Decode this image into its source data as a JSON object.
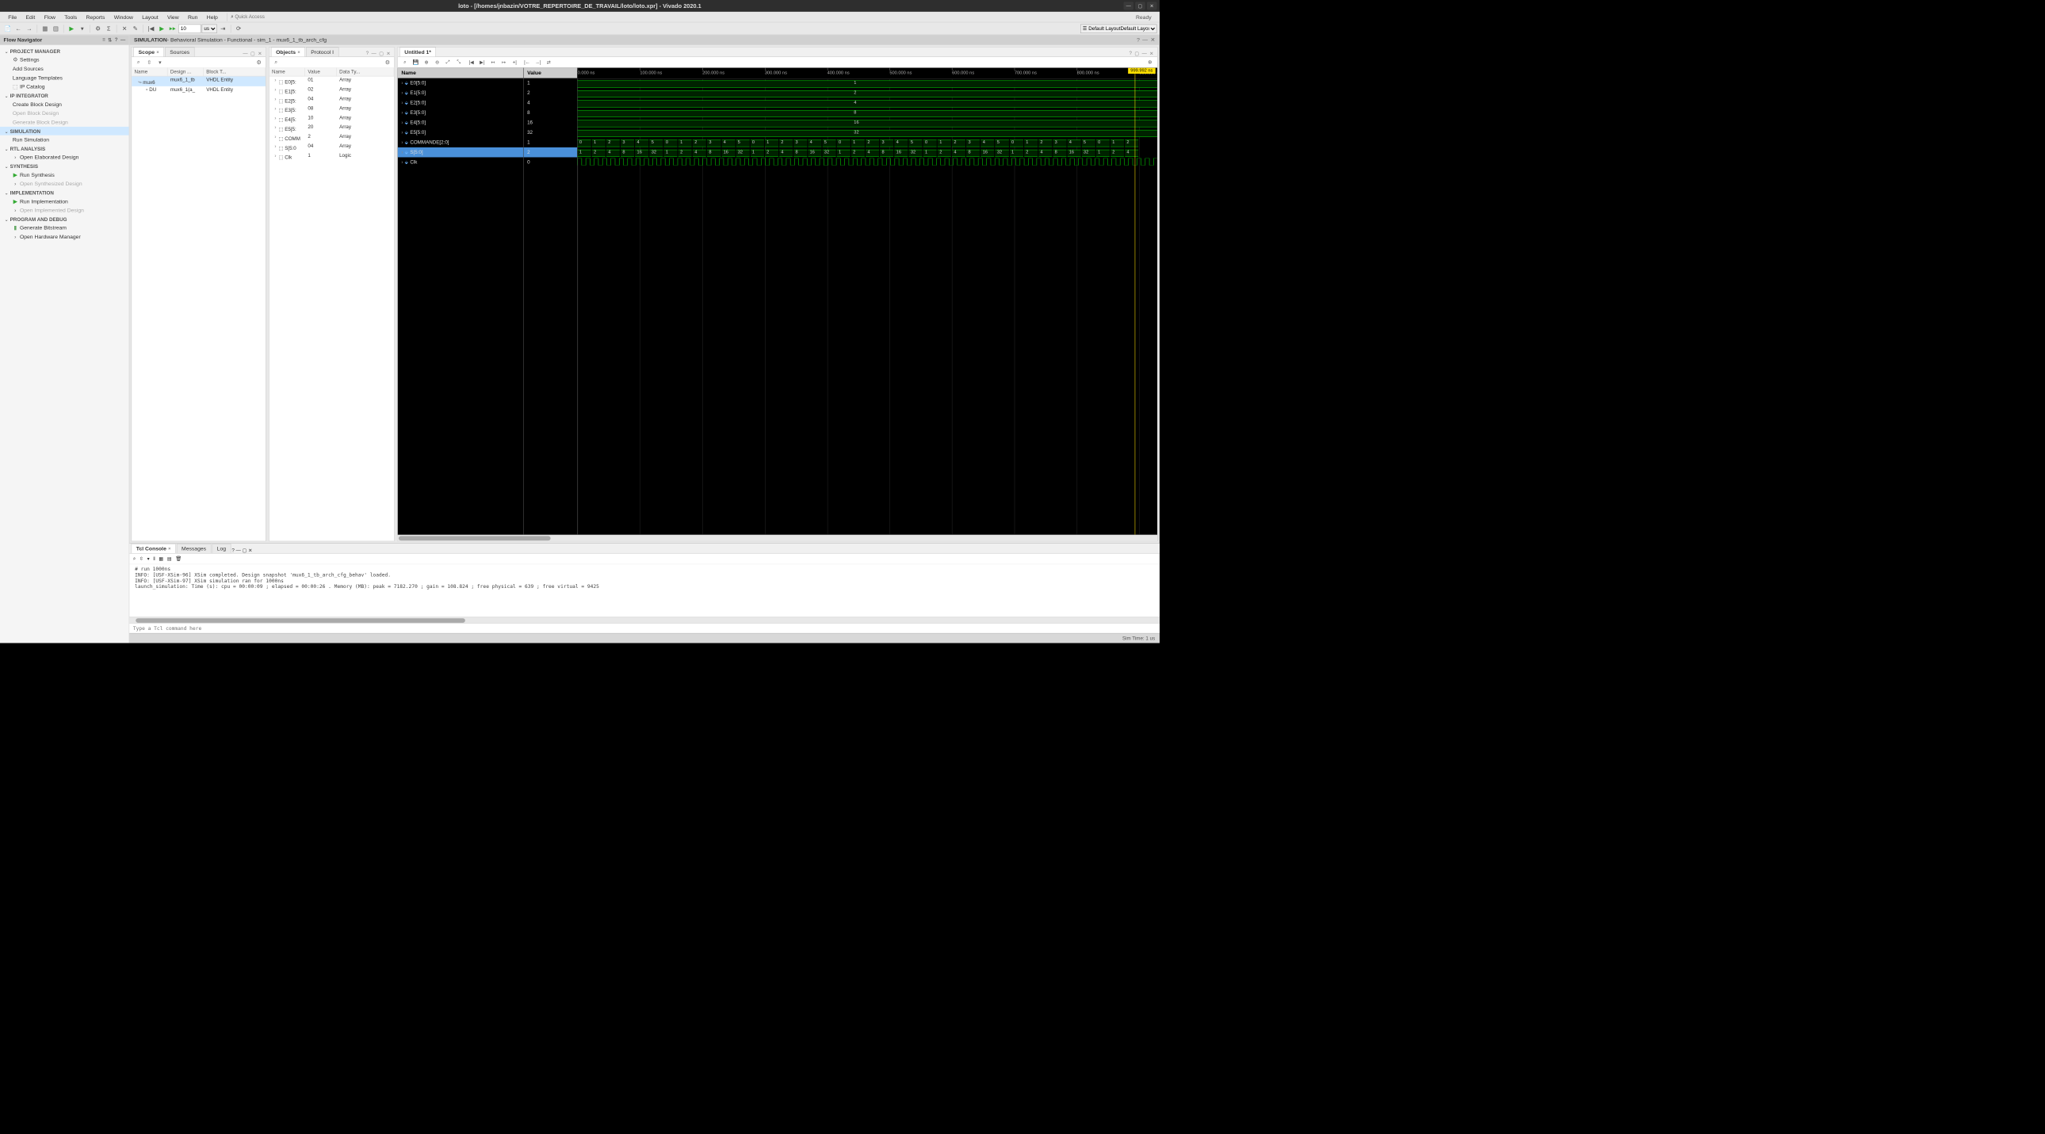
{
  "window": {
    "title": "loto - [/homes/jnbazin/VOTRE_REPERTOIRE_DE_TRAVAIL/loto/loto.xpr] - Vivado 2020.1"
  },
  "menu": [
    "File",
    "Edit",
    "Flow",
    "Tools",
    "Reports",
    "Window",
    "Layout",
    "View",
    "Run",
    "Help"
  ],
  "quick_access_placeholder": "Quick Access",
  "ready": "Ready",
  "toolbar": {
    "run_for_value": "10",
    "run_for_unit": "us",
    "layout": "Default Layout"
  },
  "flow_nav": {
    "title": "Flow Navigator",
    "sections": [
      {
        "label": "PROJECT MANAGER",
        "items": [
          {
            "label": "Settings",
            "icon": "gear"
          },
          {
            "label": "Add Sources"
          },
          {
            "label": "Language Templates"
          },
          {
            "label": "IP Catalog",
            "icon": "ip"
          }
        ]
      },
      {
        "label": "IP INTEGRATOR",
        "items": [
          {
            "label": "Create Block Design"
          },
          {
            "label": "Open Block Design",
            "disabled": true
          },
          {
            "label": "Generate Block Design",
            "disabled": true
          }
        ]
      },
      {
        "label": "SIMULATION",
        "selected": true,
        "items": [
          {
            "label": "Run Simulation"
          }
        ]
      },
      {
        "label": "RTL ANALYSIS",
        "items": [
          {
            "label": "Open Elaborated Design",
            "icon": "chev"
          }
        ]
      },
      {
        "label": "SYNTHESIS",
        "items": [
          {
            "label": "Run Synthesis",
            "icon": "play"
          },
          {
            "label": "Open Synthesized Design",
            "icon": "chev",
            "disabled": true
          }
        ]
      },
      {
        "label": "IMPLEMENTATION",
        "items": [
          {
            "label": "Run Implementation",
            "icon": "play"
          },
          {
            "label": "Open Implemented Design",
            "icon": "chev",
            "disabled": true
          }
        ]
      },
      {
        "label": "PROGRAM AND DEBUG",
        "items": [
          {
            "label": "Generate Bitstream",
            "icon": "bits"
          },
          {
            "label": "Open Hardware Manager",
            "icon": "chev"
          }
        ]
      }
    ]
  },
  "sim_header": {
    "label": "SIMULATION",
    "detail": " - Behavioral Simulation - Functional - sim_1 - mux6_1_tb_arch_cfg"
  },
  "scope": {
    "tabs": [
      "Scope",
      "Sources"
    ],
    "cols": [
      "Name",
      "Design ...",
      "Block T..."
    ],
    "rows": [
      {
        "ind": 0,
        "name": "mux6",
        "design": "mux6_1_tb",
        "block": "VHDL Entity",
        "sel": true,
        "exp": "⌄"
      },
      {
        "ind": 1,
        "name": "DU",
        "design": "mux6_1(a_",
        "block": "VHDL Entity"
      }
    ]
  },
  "objects": {
    "tabs": [
      "Objects",
      "Protocol I"
    ],
    "cols": [
      "Name",
      "Value",
      "Data Ty..."
    ],
    "rows": [
      {
        "name": "E0[5:",
        "value": "01",
        "type": "Array"
      },
      {
        "name": "E1[5:",
        "value": "02",
        "type": "Array"
      },
      {
        "name": "E2[5:",
        "value": "04",
        "type": "Array"
      },
      {
        "name": "E3[5:",
        "value": "08",
        "type": "Array"
      },
      {
        "name": "E4[5:",
        "value": "10",
        "type": "Array"
      },
      {
        "name": "E5[5:",
        "value": "20",
        "type": "Array"
      },
      {
        "name": "COMM",
        "value": "2",
        "type": "Array"
      },
      {
        "name": "S[5:0",
        "value": "04",
        "type": "Array"
      },
      {
        "name": "Clk",
        "value": "1",
        "type": "Logic"
      }
    ]
  },
  "wave": {
    "tab": "Untitled 1*",
    "name_col": "Name",
    "value_col": "Value",
    "time_badge": "999.992 ns",
    "ruler_ticks": [
      "0.000 ns",
      "100.000 ns",
      "200.000 ns",
      "300.000 ns",
      "400.000 ns",
      "500.000 ns",
      "600.000 ns",
      "700.000 ns",
      "800.000 ns",
      "900.000 ns"
    ],
    "signals": [
      {
        "name": "E0[5:0]",
        "value": "1",
        "cval": "1"
      },
      {
        "name": "E1[5:0]",
        "value": "2",
        "cval": "2"
      },
      {
        "name": "E2[5:0]",
        "value": "4",
        "cval": "4"
      },
      {
        "name": "E3[5:0]",
        "value": "8",
        "cval": "8"
      },
      {
        "name": "E4[5:0]",
        "value": "16",
        "cval": "16"
      },
      {
        "name": "E5[5:0]",
        "value": "32",
        "cval": "32"
      },
      {
        "name": "COMMANDE[2:0]",
        "value": "1",
        "seq": [
          "0",
          "1",
          "2",
          "3",
          "4",
          "5",
          "0",
          "1",
          "2",
          "3",
          "4",
          "5",
          "0",
          "1",
          "2",
          "3",
          "4",
          "5",
          "0",
          "1",
          "2",
          "3",
          "4",
          "5",
          "0",
          "1",
          "2",
          "3",
          "4",
          "5",
          "0",
          "1",
          "2",
          "3",
          "4",
          "5",
          "0",
          "1",
          "2"
        ]
      },
      {
        "name": "S[5:0]",
        "value": "2",
        "sel": true,
        "seq": [
          "1",
          "2",
          "4",
          "8",
          "16",
          "32",
          "1",
          "2",
          "4",
          "8",
          "16",
          "32",
          "1",
          "2",
          "4",
          "8",
          "16",
          "32",
          "1",
          "2",
          "4",
          "8",
          "16",
          "32",
          "1",
          "2",
          "4",
          "8",
          "16",
          "32",
          "1",
          "2",
          "4",
          "8",
          "16",
          "32",
          "1",
          "2",
          "4"
        ]
      },
      {
        "name": "Clk",
        "value": "0",
        "clk": true
      }
    ]
  },
  "console": {
    "tabs": [
      "Tcl Console",
      "Messages",
      "Log"
    ],
    "lines": [
      "# run 1000ns",
      "INFO: [USF-XSim-96] XSim completed. Design snapshot 'mux6_1_tb_arch_cfg_behav' loaded.",
      "INFO: [USF-XSim-97] XSim simulation ran for 1000ns",
      "launch_simulation: Time (s): cpu = 00:00:09 ; elapsed = 00:00:26 . Memory (MB): peak = 7182.270 ; gain = 108.824 ; free physical = 639 ; free virtual = 9425"
    ],
    "input_placeholder": "Type a Tcl command here"
  },
  "status": {
    "right": "Sim Time: 1 us"
  }
}
